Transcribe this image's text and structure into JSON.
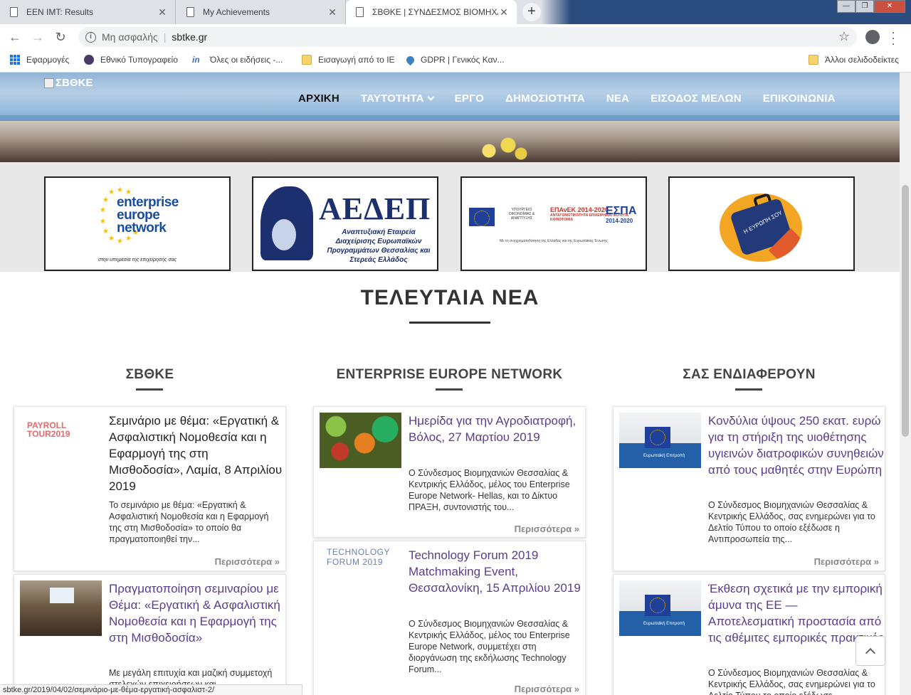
{
  "browser": {
    "tabs": [
      {
        "title": "EEN IMT: Results"
      },
      {
        "title": "My Achievements"
      },
      {
        "title": "ΣΒΘΚΕ | ΣΥΝΔΕΣΜΟΣ ΒΙΟΜΗΧΑΝ"
      }
    ],
    "new_tab": "+",
    "address": {
      "security": "Μη ασφαλής",
      "separator": "|",
      "url": "sbtke.gr"
    },
    "bookmarks": [
      {
        "label": "Εφαρμογές"
      },
      {
        "label": "Εθνικό Τυπογραφείο"
      },
      {
        "label": "Όλες οι ειδήσεις -..."
      },
      {
        "label": "Εισαγωγή από το IE"
      },
      {
        "label": "GDPR | Γενικός Καν..."
      },
      {
        "label": "Άλλοι σελιδοδείκτες"
      }
    ],
    "status_url": "sbtke.gr/2019/04/02/σεμινάριο-με-θέμα-εργατική-ασφαλιστ-2/"
  },
  "site": {
    "logo_text": "ΣΒΘΚΕ",
    "nav": [
      {
        "label": "ΑΡΧΙΚΗ"
      },
      {
        "label": "ΤΑΥΤΟΤΗΤΑ"
      },
      {
        "label": "ΕΡΓΟ"
      },
      {
        "label": "ΔΗΜΟΣΙΟΤΗΤΑ"
      },
      {
        "label": "ΝΕΑ"
      },
      {
        "label": "ΕΙΣΟΔΟΣ ΜΕΛΩΝ"
      },
      {
        "label": "ΕΠΙΚΟΙΝΩΝΙΑ"
      }
    ]
  },
  "partners": {
    "een": {
      "line1": "enterprise",
      "line2": "europe",
      "line3": "network",
      "tagline": "στην υπηρεσία της επιχείρησής σας"
    },
    "aedep": {
      "title": "ΑΕΔΕΠ",
      "subtitle": "Αναπτυξιακή Εταιρεία Διαχείρισης Ευρωπαϊκών Προγραμμάτων Θεσσαλίας και Στερεάς Ελλάδος"
    },
    "espa": {
      "ministry": "ΥΠΟΥΡΓΕΙΟ ΟΙΚΟΝΟΜΙΑΣ & ΑΝΑΠΤΥΞΗΣ",
      "program": "ΕΠΑνΕΚ 2014-2020",
      "program_sub": "ΑΝΤΑΓΩΝΙΣΤΙΚΟΤΗΤΑ ΕΠΙΧΕΙΡΗΜΑΤΙΚΟΤΗΤΑ ΚΑΙΝΟΤΟΜΙΑ",
      "espa": "ΕΣΠΑ",
      "espa_years": "2014-2020",
      "footer": "Με τη συγχρηματοδότηση της Ελλάδας και της Ευρωπαϊκής Ένωσης"
    },
    "europe": {
      "text": "Η ΕΥΡΩΠΗ ΣΟΥ"
    }
  },
  "news": {
    "title": "ΤΕΛΕΥΤΑΙΑ ΝΕΑ",
    "columns": [
      {
        "title": "ΣΒΘΚΕ",
        "cards": [
          {
            "thumb_label": "PAYROLL TOUR2019",
            "headline": "Σεμινάριο με θέμα: «Εργατική & Ασφαλιστική Νομοθεσία και η Εφαρμογή της στη Μισθοδοσία», Λαμία, 8 Απριλίου 2019",
            "excerpt": "Το σεμινάριο με θέμα: «Εργατική & Ασφαλιστική Νομοθεσία και η Εφαρμογή της στη Μισθοδοσία» το οποίο θα πραγματοποιηθεί την...",
            "more": "Περισσότερα »"
          },
          {
            "headline": "Πραγματοποίηση σεμιναρίου με Θέμα: «Εργατική & Ασφαλιστική Νομοθεσία και η Εφαρμογή της στη Μισθοδοσία»",
            "excerpt": "Με μεγάλη επιτυχία και μαζική συμμετοχή στελεχών επιχειρήσεων και"
          }
        ]
      },
      {
        "title": "ENTERPRISE EUROPE NETWORK",
        "cards": [
          {
            "headline": "Ημερίδα για την Αγροδιατροφή, Βόλος, 27 Μαρτίου 2019",
            "excerpt": "Ο Σύνδεσμος Βιομηχανιών Θεσσαλίας & Κεντρικής Ελλάδος, μέλος του Enterprise Europe Network- Hellas, και το Δίκτυο ΠΡΑΞΗ, συντονιστής του...",
            "more": "Περισσότερα »"
          },
          {
            "thumb_label": "TECHNOLOGY FORUM 2019",
            "headline": "Technology Forum 2019 Matchmaking Event, Θεσσαλονίκη, 15 Απριλίου 2019",
            "excerpt": "Ο Σύνδεσμος Βιομηχανιών Θεσσαλίας & Κεντρικής Ελλάδος, μέλος του Enterprise Europe Network, συμμετέχει στη διοργάνωση της εκδήλωσης Technology Forum...",
            "more": "Περισσότερα »"
          }
        ]
      },
      {
        "title": "ΣΑΣ ΕΝΔΙΑΦΕΡΟΥΝ",
        "cards": [
          {
            "thumb_label": "Ευρωπαϊκή Επιτροπή",
            "headline": "Κονδύλια ύψους 250 εκατ. ευρώ για τη στήριξη της υιοθέτησης υγιεινών διατροφικών συνηθειών από τους μαθητές στην Ευρώπη",
            "excerpt": "Ο Σύνδεσμος Βιομηχανιών Θεσσαλίας & Κεντρικής Ελλάδος, σας ενημερώνει για το Δελτίο Τύπου το οποίο εξέδωσε η Αντιπροσωπεία της...",
            "more": "Περισσότερα »"
          },
          {
            "thumb_label": "Ευρωπαϊκή Επιτροπή",
            "headline": "Έκθεση σχετικά με την εμπορική άμυνα της ΕΕ — Αποτελεσματική προστασία από τις αθέμιτες εμπορικές πρακτικές",
            "excerpt": "Ο Σύνδεσμος Βιομηχανιών Θεσσαλίας & Κεντρικής Ελλάδος, σας ενημερώνει για το Δελτίο Τύπου το οποίο εξέδωσε"
          }
        ]
      }
    ]
  }
}
